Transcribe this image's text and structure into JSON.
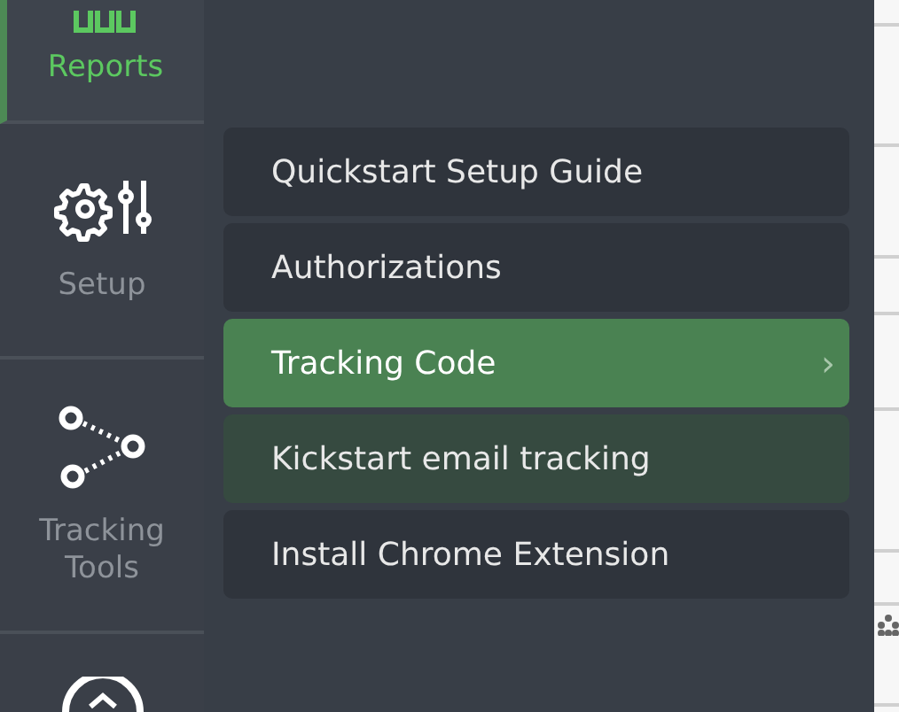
{
  "nav_items": [
    {
      "label": "Reports",
      "selected": true
    },
    {
      "label": "Setup",
      "selected": false
    },
    {
      "label": "Tracking Tools",
      "selected": false
    },
    {
      "selected": false
    }
  ],
  "submenu": [
    {
      "label": "Quickstart Setup Guide",
      "selected": false,
      "hovered": false
    },
    {
      "label": "Authorizations",
      "selected": false,
      "hovered": false
    },
    {
      "label": "Tracking Code",
      "selected": true,
      "hovered": false,
      "arrow": "›"
    },
    {
      "label": "Kickstart email tracking",
      "selected": false,
      "hovered": true
    },
    {
      "label": "Install Chrome Extension",
      "selected": false,
      "hovered": false
    }
  ]
}
